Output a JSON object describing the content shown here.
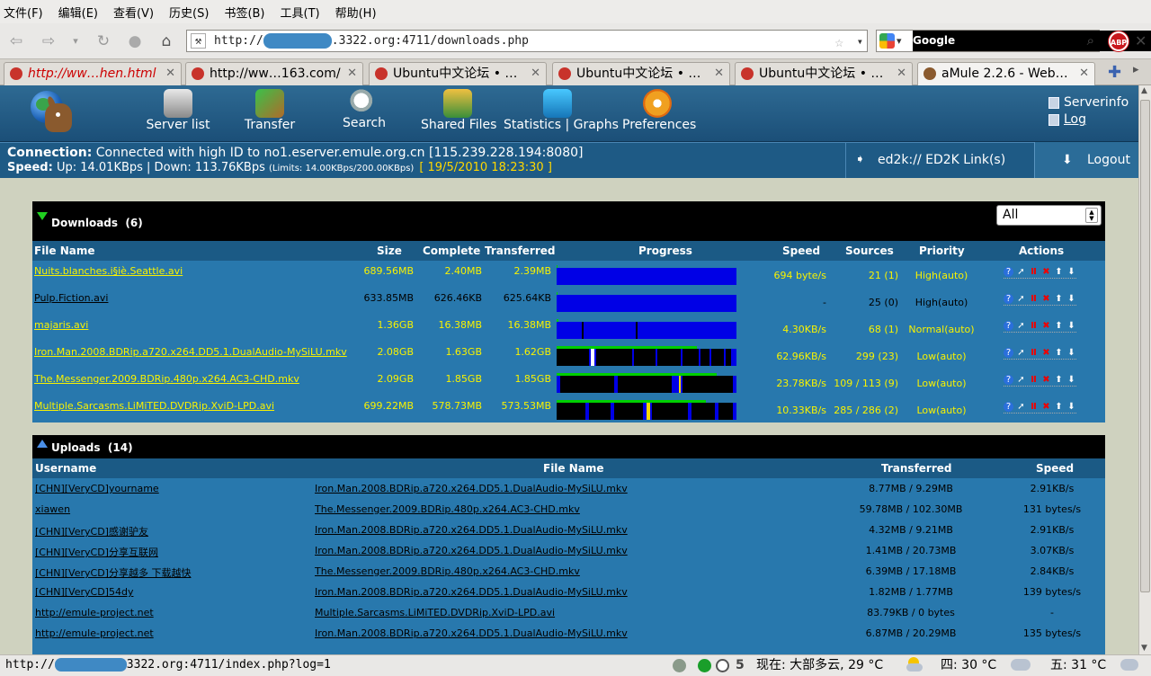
{
  "menubar": [
    "文件(F)",
    "编辑(E)",
    "查看(V)",
    "历史(S)",
    "书签(B)",
    "工具(T)",
    "帮助(H)"
  ],
  "navbar": {
    "url_prefix": "http://",
    "url_suffix": ".3322.org:4711/downloads.php",
    "search_placeholder": "Google",
    "abp_label": "ABP"
  },
  "tabs": [
    {
      "label": "http://ww…hen.html",
      "active": false
    },
    {
      "label": "http://ww…163.com/",
      "active": false
    },
    {
      "label": "Ubuntu中文论坛 • …",
      "active": false
    },
    {
      "label": "Ubuntu中文论坛 • …",
      "active": false
    },
    {
      "label": "Ubuntu中文论坛 • …",
      "active": false
    },
    {
      "label": "aMule 2.2.6 - Web…",
      "active": true
    }
  ],
  "amule": {
    "nav": [
      {
        "label": "Server list",
        "icon": "server-list-icon"
      },
      {
        "label": "Transfer",
        "icon": "transfer-icon"
      },
      {
        "label": "Search",
        "icon": "search-icon"
      },
      {
        "label": "Shared Files",
        "icon": "shared-files-icon"
      },
      {
        "label": "Statistics",
        "label2": "Graphs",
        "icon": "statistics-icon"
      },
      {
        "label": "Preferences",
        "icon": "preferences-icon"
      }
    ],
    "right_links": [
      "Serverinfo",
      "Log"
    ],
    "connection_label": "Connection:",
    "connection_text": "Connected with high ID to no1.eserver.emule.org.cn [115.239.228.194:8080]",
    "speed_label": "Speed:",
    "speed_text": "Up: 14.01KBps | Down: 113.76KBps",
    "speed_limits": "(Limits: 14.00KBps/200.00KBps)",
    "timestamp": "[ 19/5/2010 18:23:30 ]",
    "ed2k_label": "ed2k:// ED2K Link(s)",
    "logout_label": "Logout"
  },
  "downloads": {
    "title": "Downloads",
    "count": "(6)",
    "filter": "All",
    "columns": [
      "File Name",
      "Size",
      "Complete",
      "Transferred",
      "Progress",
      "Speed",
      "Sources",
      "Priority",
      "Actions"
    ],
    "rows": [
      {
        "name": "Nuits.blanches.i§iè.Seattle.avi",
        "size": "689.56MB",
        "complete": "2.40MB",
        "transferred": "2.39MB",
        "speed": "694 byte/s",
        "sources": "21 (1)",
        "priority": "High(auto)",
        "highlight": true,
        "progress": 0.0035,
        "gaps": []
      },
      {
        "name": "Pulp.Fiction.avi",
        "size": "633.85MB",
        "complete": "626.46KB",
        "transferred": "625.64KB",
        "speed": "-",
        "sources": "25 (0)",
        "priority": "High(auto)",
        "highlight": false,
        "progress": 0.001,
        "gaps": []
      },
      {
        "name": "majaris.avi",
        "size": "1.36GB",
        "complete": "16.38MB",
        "transferred": "16.38MB",
        "speed": "4.30KB/s",
        "sources": "68 (1)",
        "priority": "Normal(auto)",
        "highlight": true,
        "progress": 0.012,
        "gaps": [
          {
            "s": 0.14,
            "w": 0.01,
            "c": "#000"
          },
          {
            "s": 0.44,
            "w": 0.01,
            "c": "#000"
          }
        ]
      },
      {
        "name": "Iron.Man.2008.BDRip.a720.x264.DD5.1.DualAudio-MySiLU.mkv",
        "size": "2.08GB",
        "complete": "1.63GB",
        "transferred": "1.62GB",
        "speed": "62.96KB/s",
        "sources": "299 (23)",
        "priority": "Low(auto)",
        "highlight": true,
        "progress": 0.78,
        "gaps": [
          {
            "s": 0.0,
            "w": 0.18,
            "c": "#000"
          },
          {
            "s": 0.19,
            "w": 0.02,
            "c": "#fff"
          },
          {
            "s": 0.22,
            "w": 0.2,
            "c": "#000"
          },
          {
            "s": 0.43,
            "w": 0.12,
            "c": "#000"
          },
          {
            "s": 0.56,
            "w": 0.13,
            "c": "#000"
          },
          {
            "s": 0.7,
            "w": 0.09,
            "c": "#000"
          },
          {
            "s": 0.8,
            "w": 0.05,
            "c": "#000"
          },
          {
            "s": 0.86,
            "w": 0.07,
            "c": "#000"
          },
          {
            "s": 0.94,
            "w": 0.03,
            "c": "#000"
          }
        ]
      },
      {
        "name": "The.Messenger.2009.BDRip.480p.x264.AC3-CHD.mkv",
        "size": "2.09GB",
        "complete": "1.85GB",
        "transferred": "1.85GB",
        "speed": "23.78KB/s",
        "sources": "109 / 113 (9)",
        "priority": "Low(auto)",
        "highlight": true,
        "progress": 0.89,
        "gaps": [
          {
            "s": 0.02,
            "w": 0.3,
            "c": "#000"
          },
          {
            "s": 0.34,
            "w": 0.3,
            "c": "#000"
          },
          {
            "s": 0.68,
            "w": 0.01,
            "c": "#ffd700"
          },
          {
            "s": 0.7,
            "w": 0.28,
            "c": "#000"
          }
        ]
      },
      {
        "name": "Multiple.Sarcasms.LiMiTED.DVDRip.XviD-LPD.avi",
        "size": "699.22MB",
        "complete": "578.73MB",
        "transferred": "573.53MB",
        "speed": "10.33KB/s",
        "sources": "285 / 286 (2)",
        "priority": "Low(auto)",
        "highlight": true,
        "progress": 0.83,
        "gaps": [
          {
            "s": 0.0,
            "w": 0.16,
            "c": "#000"
          },
          {
            "s": 0.18,
            "w": 0.12,
            "c": "#000"
          },
          {
            "s": 0.32,
            "w": 0.16,
            "c": "#000"
          },
          {
            "s": 0.5,
            "w": 0.02,
            "c": "#ffd700"
          },
          {
            "s": 0.53,
            "w": 0.2,
            "c": "#000"
          },
          {
            "s": 0.75,
            "w": 0.13,
            "c": "#000"
          },
          {
            "s": 0.9,
            "w": 0.08,
            "c": "#000"
          }
        ]
      }
    ]
  },
  "uploads": {
    "title": "Uploads",
    "count": "(14)",
    "columns": [
      "Username",
      "File Name",
      "Transferred",
      "Speed"
    ],
    "rows": [
      {
        "user": "[CHN][VeryCD]yourname",
        "file": "Iron.Man.2008.BDRip.a720.x264.DD5.1.DualAudio-MySiLU.mkv",
        "transferred": "8.77MB / 9.29MB",
        "speed": "2.91KB/s"
      },
      {
        "user": "xiawen",
        "file": "The.Messenger.2009.BDRip.480p.x264.AC3-CHD.mkv",
        "transferred": "59.78MB / 102.30MB",
        "speed": "131 bytes/s"
      },
      {
        "user": "[CHN][VeryCD]感谢驴友",
        "file": "Iron.Man.2008.BDRip.a720.x264.DD5.1.DualAudio-MySiLU.mkv",
        "transferred": "4.32MB / 9.21MB",
        "speed": "2.91KB/s"
      },
      {
        "user": "[CHN][VeryCD]分享互联网",
        "file": "Iron.Man.2008.BDRip.a720.x264.DD5.1.DualAudio-MySiLU.mkv",
        "transferred": "1.41MB / 20.73MB",
        "speed": "3.07KB/s"
      },
      {
        "user": "[CHN][VeryCD]分享越多 下载越快",
        "file": "The.Messenger.2009.BDRip.480p.x264.AC3-CHD.mkv",
        "transferred": "6.39MB / 17.18MB",
        "speed": "2.84KB/s"
      },
      {
        "user": "[CHN][VeryCD]54dy",
        "file": "Iron.Man.2008.BDRip.a720.x264.DD5.1.DualAudio-MySiLU.mkv",
        "transferred": "1.82MB / 1.77MB",
        "speed": "139 bytes/s"
      },
      {
        "user": "http://emule-project.net",
        "file": "Multiple.Sarcasms.LiMiTED.DVDRip.XviD-LPD.avi",
        "transferred": "83.79KB / 0 bytes",
        "speed": "-"
      },
      {
        "user": "http://emule-project.net",
        "file": "Iron.Man.2008.BDRip.a720.x264.DD5.1.DualAudio-MySiLU.mkv",
        "transferred": "6.87MB / 20.29MB",
        "speed": "135 bytes/s"
      }
    ]
  },
  "statusbar": {
    "url_prefix": "http://",
    "url_suffix": "3322.org:4711/index.php?log=1",
    "counter": "5",
    "weather_now": "现在: 大部多云, 29 °C",
    "weather_thu": "四: 30 °C",
    "weather_fri": "五: 31 °C"
  },
  "colors": {
    "accent": "#1b5a85",
    "row_bg": "#2878ad",
    "highlight_text": "#f8f200"
  }
}
